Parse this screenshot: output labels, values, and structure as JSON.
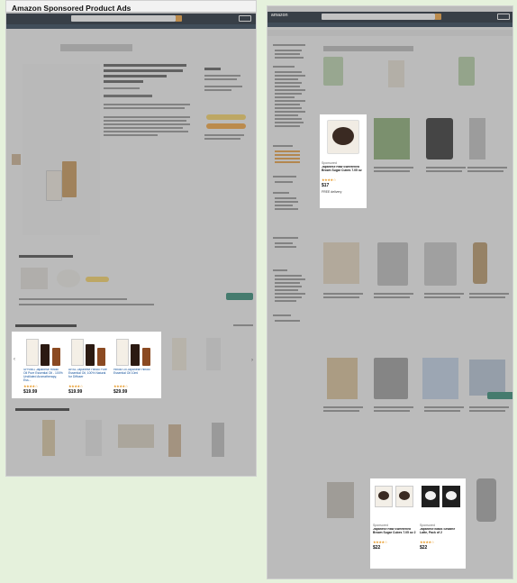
{
  "left_panel": {
    "title": "Amazon Sponsored Product Ads"
  },
  "right_panel": {
    "logo": "amazon"
  },
  "left_highlight": {
    "arrow_left": "‹",
    "arrow_right": "›",
    "cards": [
      {
        "title": "SPRING Japanese Hinoki Oil Pure Essential Oil - 100% Undiluted Aromatherapy, Ess...",
        "stars": "★★★★☆",
        "price": "$19.99"
      },
      {
        "title": "ARSL Japanese Hinoki Pure Essential Oil, 100% Natural for Diffuser",
        "stars": "★★★★☆",
        "price": "$19.99"
      },
      {
        "title": "Hinoki Oil Japanese Hinoki Essential Oil 10ml",
        "stars": "★★★★☆",
        "price": "$29.99"
      }
    ]
  },
  "right_highlight_top": {
    "label": "Sponsored",
    "title": "Japanese Raw Sweetened Brown Sugar Cubes 7.05 oz",
    "stars": "★★★★☆",
    "price": "$17",
    "note": "FREE delivery"
  },
  "right_highlight_bottom": {
    "cards": [
      {
        "label": "Sponsored",
        "title": "Japanese Raw Sweetened Brown Sugar Cubes 7.05 oz 2",
        "stars": "★★★★☆",
        "price": "$22"
      },
      {
        "label": "Sponsored",
        "title": "Japanese Black Sesame Latte, Pack of 2",
        "stars": "★★★★☆",
        "price": "$22"
      }
    ]
  },
  "colors": {
    "header": "#26313d",
    "accent": "#f3a847",
    "background": "#e5f1dc"
  }
}
